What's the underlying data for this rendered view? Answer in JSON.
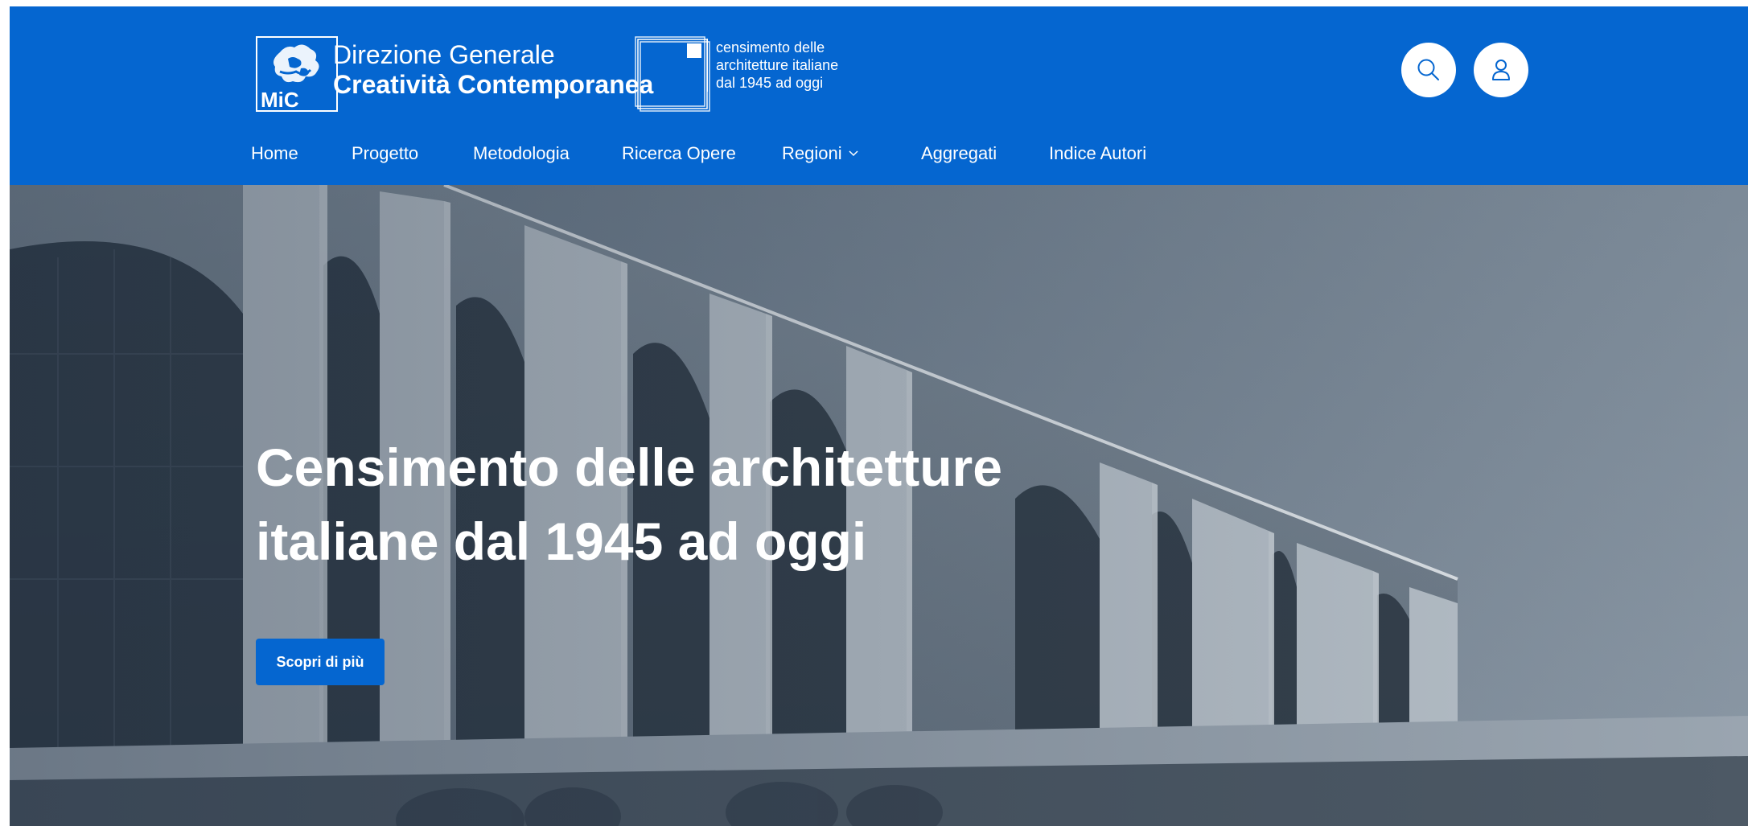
{
  "header": {
    "org_line1": "Direzione Generale",
    "org_line2": "Creatività Contemporanea",
    "mic_label": "MiC",
    "census_lines": [
      "censimento delle",
      "architetture italiane",
      "dal 1945 ad oggi"
    ],
    "search_icon": "search-icon",
    "user_icon": "user-icon",
    "brand_color": "#0566d0"
  },
  "nav": {
    "items": [
      {
        "label": "Home"
      },
      {
        "label": "Progetto"
      },
      {
        "label": "Metodologia"
      },
      {
        "label": "Ricerca Opere"
      },
      {
        "label": "Regioni",
        "dropdown": true
      },
      {
        "label": "Aggregati"
      },
      {
        "label": "Indice Autori"
      }
    ]
  },
  "hero": {
    "title_lines": [
      "Censimento delle architetture",
      "italiane dal 1945 ad oggi"
    ],
    "cta_label": "Scopri di più"
  }
}
